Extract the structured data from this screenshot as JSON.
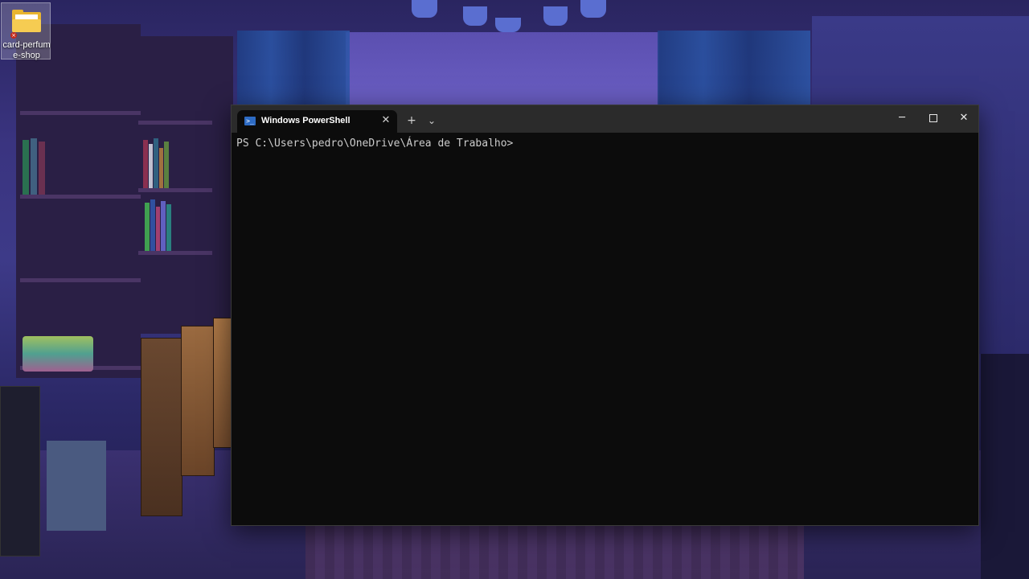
{
  "desktop": {
    "icons": [
      {
        "label_line1": "card-perfum",
        "label_line2": "e-shop",
        "icon": "folder-icon",
        "badge": "error-badge-icon"
      }
    ]
  },
  "terminal": {
    "tab_title": "Windows PowerShell",
    "tab_icon": "powershell-icon",
    "tab_close_glyph": "✕",
    "new_tab_glyph": "+",
    "dropdown_glyph": "⌄",
    "minimize_glyph": "─",
    "close_glyph": "✕",
    "prompt": "PS C:\\Users\\pedro\\OneDrive\\Área de Trabalho>",
    "background": "#0c0c0c",
    "titlebar_color": "#2b2b2b"
  }
}
